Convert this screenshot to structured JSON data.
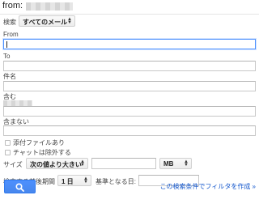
{
  "header": {
    "from_text": "from:"
  },
  "search": {
    "scope_label": "検索",
    "scope_value": "すべてのメール"
  },
  "fields": {
    "from_label": "From",
    "to_label": "To",
    "subject_label": "件名",
    "has_words_label": "含む",
    "no_words_label": "含まない"
  },
  "checkboxes": {
    "has_attachment": "添付ファイルあり",
    "exclude_chats": "チャットは除外する"
  },
  "size": {
    "label": "サイズ",
    "operator_value": "次の値より大きい",
    "value": "",
    "unit_value": "MB"
  },
  "date": {
    "label": "検索する前後期間",
    "range_value": "1 日",
    "base_label": "基準となる日:",
    "base_value": ""
  },
  "actions": {
    "search_icon": "search-icon",
    "create_filter_link": "この検索条件でフィルタを作成 »"
  },
  "colors": {
    "accent": "#4d90fe",
    "link": "#1155cc"
  }
}
